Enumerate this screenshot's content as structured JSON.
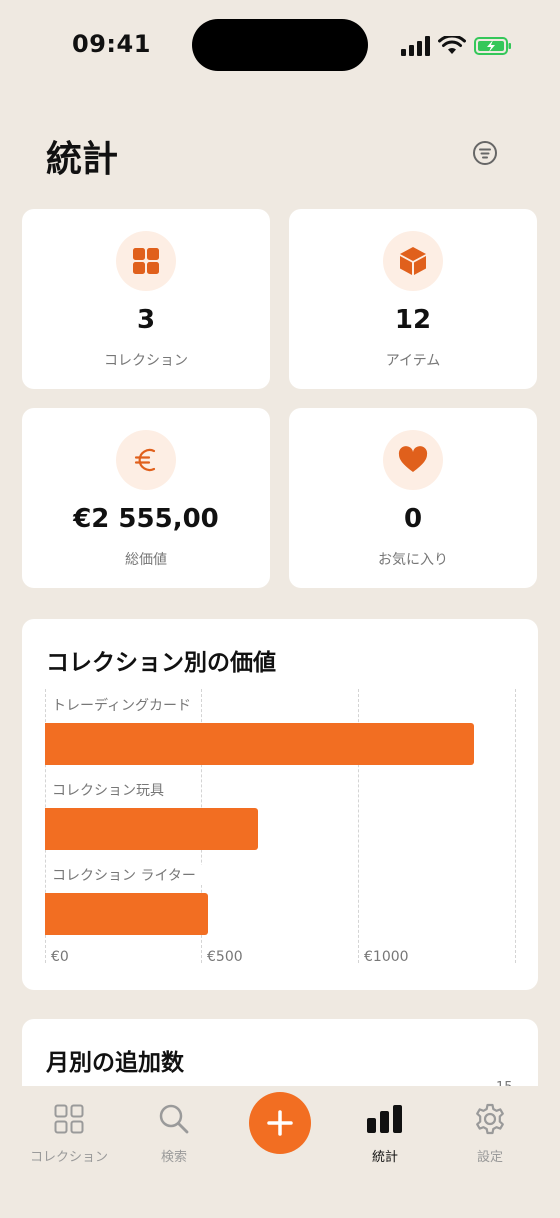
{
  "status_bar": {
    "time": "09:41"
  },
  "header": {
    "title": "統計"
  },
  "stats": [
    {
      "value": "3",
      "label": "コレクション",
      "icon": "grid-icon"
    },
    {
      "value": "12",
      "label": "アイテム",
      "icon": "cube-icon"
    },
    {
      "value": "€2 555,00",
      "label": "総価値",
      "icon": "euro-icon"
    },
    {
      "value": "0",
      "label": "お気に入り",
      "icon": "heart-icon"
    }
  ],
  "value_chart": {
    "title": "コレクション別の価値",
    "colors": {
      "bar": "#f26e22"
    },
    "chart_data": {
      "type": "bar",
      "orientation": "horizontal",
      "categories": [
        "トレーディングカード",
        "コレクション玩具",
        "コレクション ライター"
      ],
      "values": [
        1370,
        680,
        520
      ],
      "xlim": [
        0,
        1500
      ],
      "xticks": [
        "€0",
        "€500",
        "€1000"
      ],
      "grid": true
    }
  },
  "monthly_chart": {
    "title": "月別の追加数",
    "partial_tick": "15"
  },
  "tab_bar": {
    "items": [
      {
        "label": "コレクション",
        "icon": "grid-icon"
      },
      {
        "label": "検索",
        "icon": "search-icon"
      },
      {
        "label": "統計",
        "icon": "bar-chart-icon",
        "active": true
      },
      {
        "label": "設定",
        "icon": "gear-icon"
      }
    ],
    "fab_icon": "plus-icon"
  },
  "accent_color": "#f26e22"
}
